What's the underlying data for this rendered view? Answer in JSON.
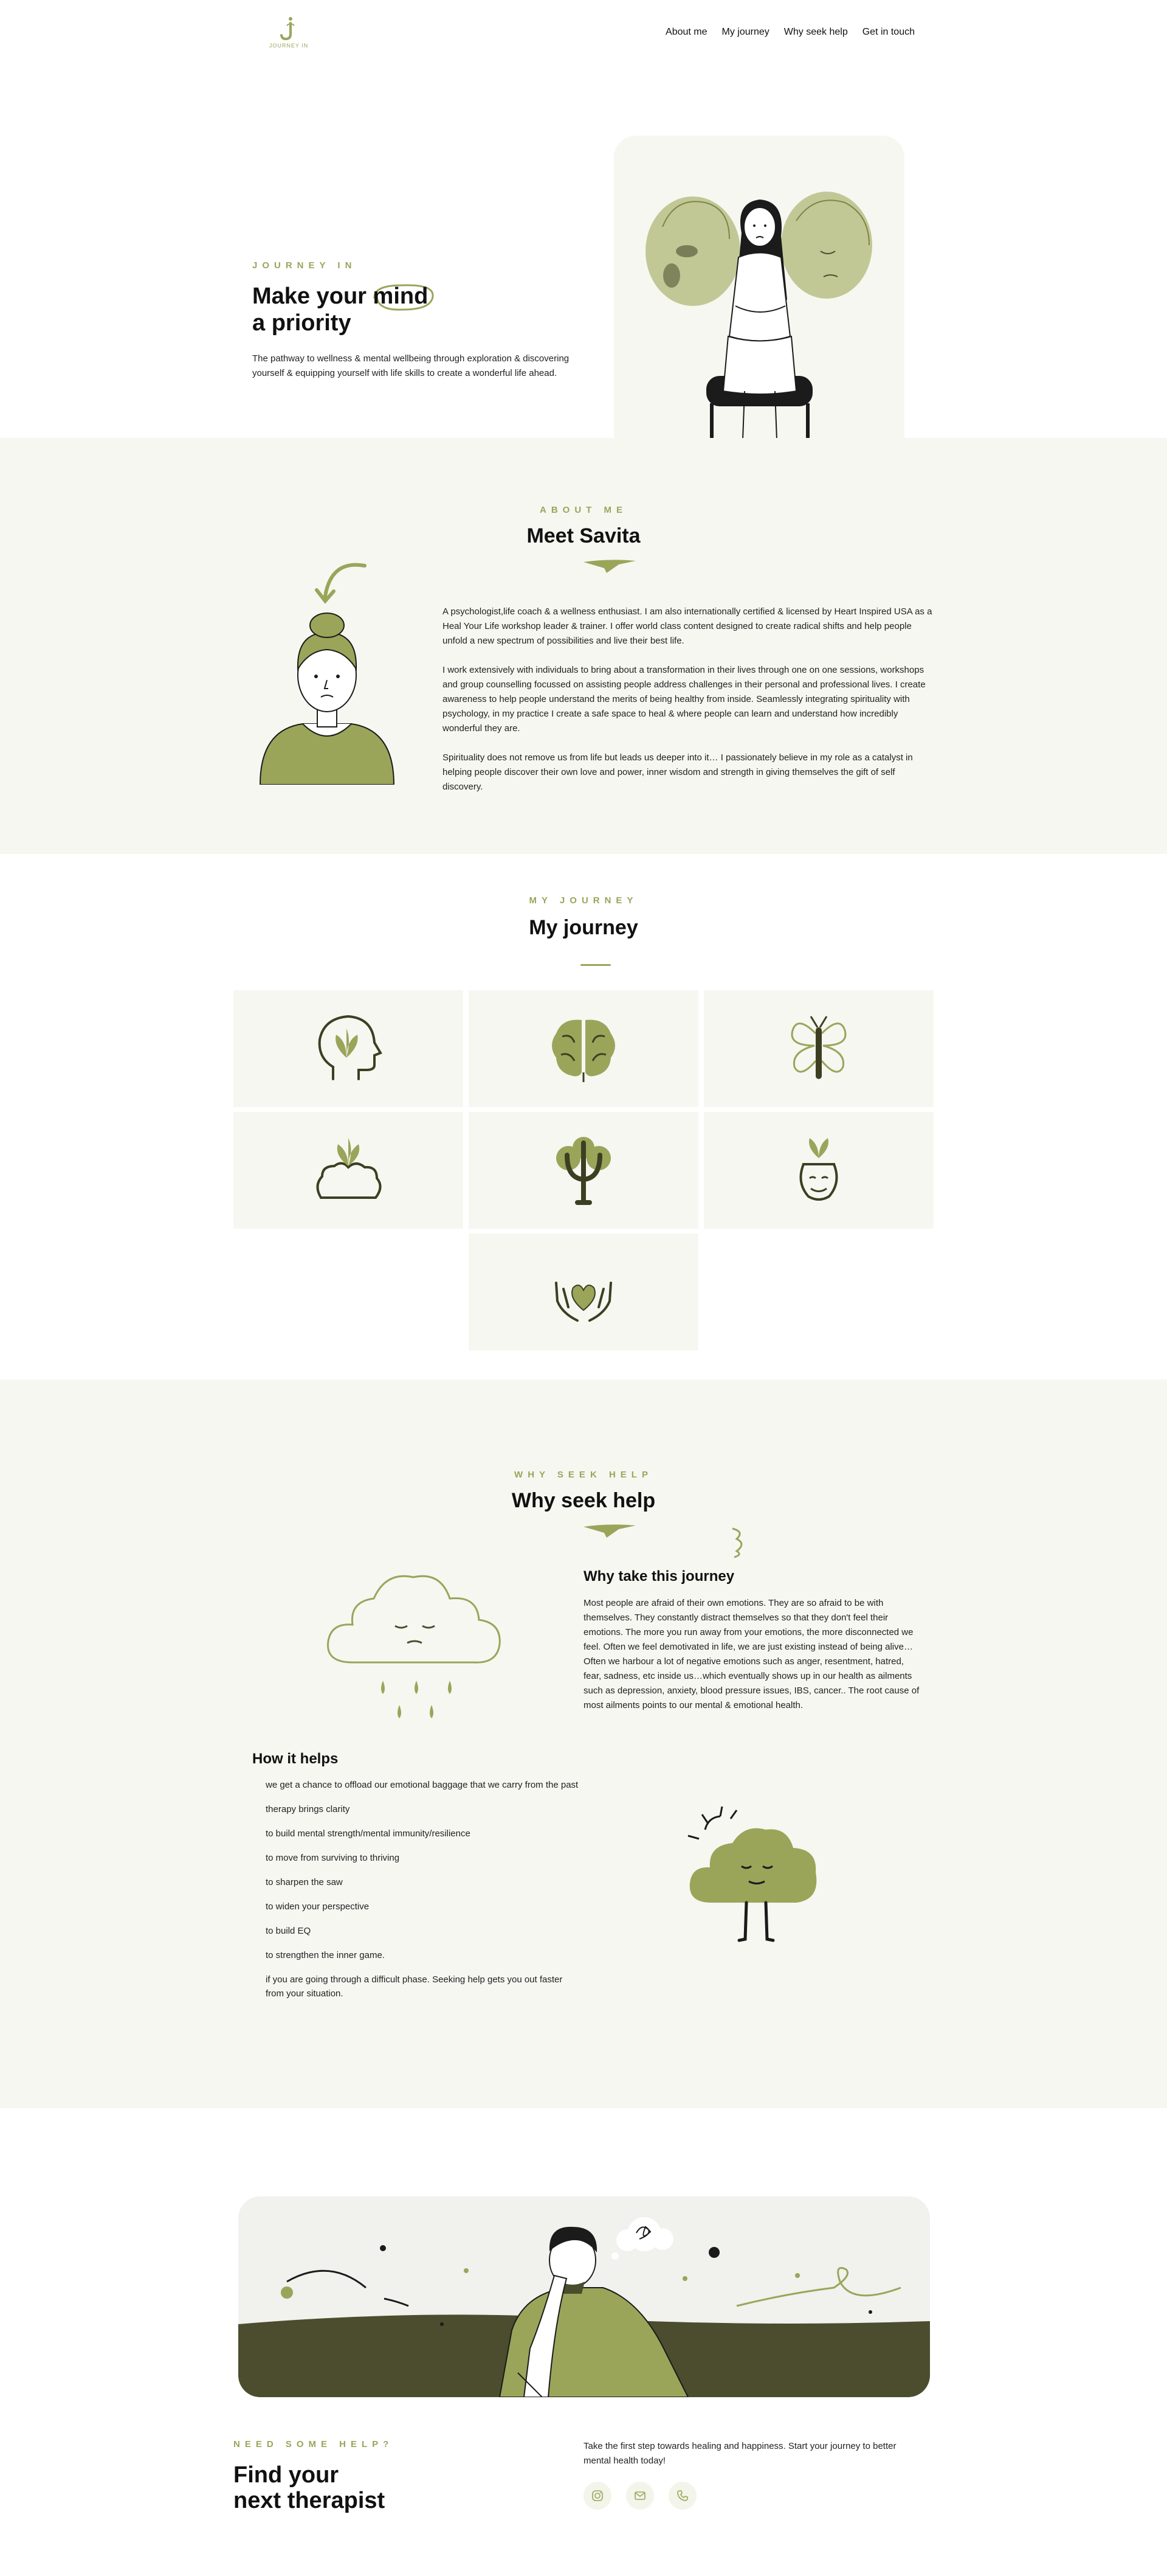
{
  "header": {
    "logo_text": "JOURNEY IN",
    "nav": [
      "About me",
      "My journey",
      "Why seek help",
      "Get in touch"
    ]
  },
  "hero": {
    "eyebrow": "JOURNEY IN",
    "title_part1": "Make your ",
    "title_highlight": "mind",
    "title_part2": "a priority",
    "subtitle": "The pathway to wellness & mental wellbeing through exploration & discovering yourself & equipping yourself with life skills to create a wonderful life ahead."
  },
  "about": {
    "eyebrow": "ABOUT ME",
    "title": "Meet Savita",
    "paragraphs": [
      "A psychologist,life coach & a wellness enthusiast. I am also internationally certified & licensed by Heart Inspired USA as a Heal Your Life workshop leader & trainer. I offer world class content designed to create radical shifts and help people unfold a new spectrum of possibilities and live their best life.",
      "I work extensively with individuals to bring about a transformation in their lives through one on one sessions, workshops and group counselling focussed on assisting people address challenges in their personal and professional lives. I create awareness to help people understand the merits of being healthy from inside. Seamlessly integrating spirituality with psychology, in my practice I create a safe space to heal & where people can learn and understand how incredibly wonderful they are.",
      "Spirituality does not remove us from life but leads us deeper into it… I passionately believe in my role as a catalyst in helping people discover their own love and power, inner wisdom and strength in giving themselves the gift of self discovery."
    ]
  },
  "journey": {
    "eyebrow": "MY JOURNEY",
    "title": "My journey",
    "icons": [
      "head-plant-icon",
      "brain-icon",
      "butterfly-icon",
      "brain-sprout-icon",
      "psi-tree-icon",
      "happy-head-plant-icon",
      "hands-heart-icon"
    ]
  },
  "why": {
    "eyebrow": "WHY SEEK HELP",
    "title": "Why seek help",
    "take_title": "Why take this journey",
    "take_text": "Most people are afraid of their own emotions. They are so afraid to be with themselves. They constantly distract themselves so that they don't feel their emotions. The more you run away from your emotions, the more disconnected we feel. Often we feel demotivated in life, we are just existing instead of being alive… Often we harbour a lot of negative emotions such as anger, resentment, hatred, fear, sadness, etc inside us…which eventually shows up in our health as ailments such as depression, anxiety, blood pressure issues, IBS, cancer.. The root cause of most ailments points to our mental & emotional health.",
    "help_title": "How it helps",
    "help_items": [
      "we get a chance to offload our emotional baggage that we carry from the past",
      "therapy brings clarity",
      "to build mental strength/mental immunity/resilience",
      "to move from surviving to thriving",
      "to sharpen the saw",
      "to widen your perspective",
      "to build EQ",
      "to strengthen the inner game.",
      "if you are going through a difficult phase. Seeking help gets you out faster from your situation."
    ]
  },
  "find": {
    "eyebrow": "NEED SOME HELP?",
    "title_line1": "Find your",
    "title_line2": "next therapist",
    "cta": "Take the first step towards healing and happiness. Start your journey to better mental health today!",
    "socials": [
      "instagram-icon",
      "mail-icon",
      "phone-icon"
    ]
  },
  "colors": {
    "accent": "#9aa55a",
    "accent_dark": "#4b4d2e",
    "section_bg": "#f6f7f1",
    "text": "#111111"
  }
}
